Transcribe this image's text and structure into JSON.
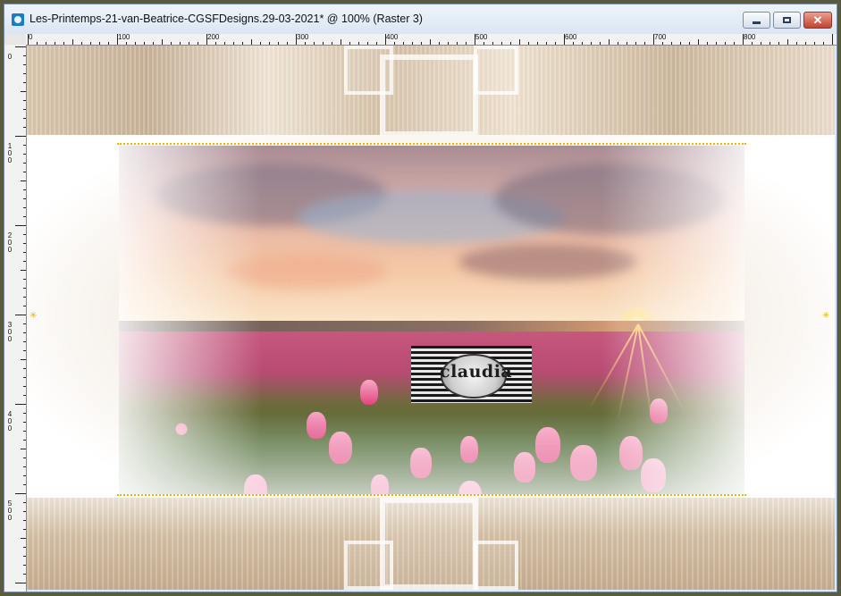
{
  "window": {
    "title": "Les-Printemps-21-van-Beatrice-CGSFDesigns.29-03-2021* @ 100% (Raster 3)",
    "controls": {
      "minimize": "minimize",
      "maximize": "maximize",
      "close": "✕"
    }
  },
  "rulers": {
    "top_labels": [
      "0",
      "100",
      "200",
      "300",
      "400",
      "500",
      "600",
      "700",
      "800"
    ],
    "left_labels": [
      "0",
      "100",
      "200",
      "300",
      "400",
      "500"
    ]
  },
  "canvas": {
    "watermark_text": "claudia",
    "accent_color": "#f2b400",
    "frame_color_top": "#d9c6ae",
    "frame_color_bottom": "#c7ae91"
  }
}
